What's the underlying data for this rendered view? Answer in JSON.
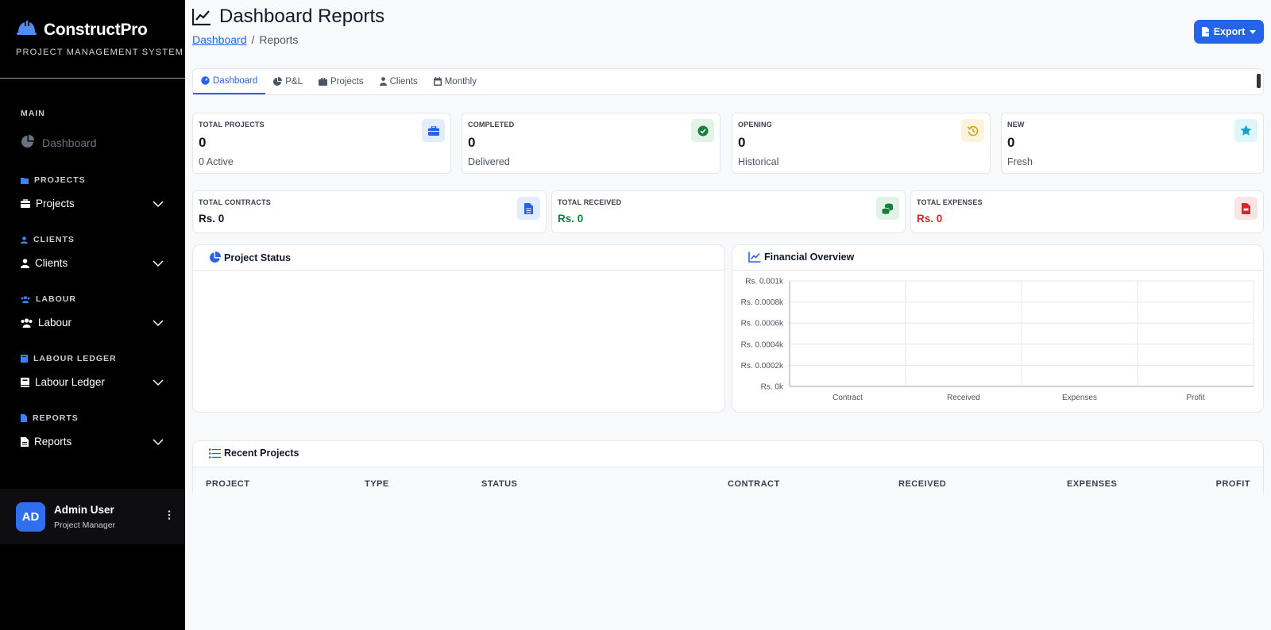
{
  "sidebar": {
    "brand_title": "ConstructPro",
    "brand_subtitle": "PROJECT MANAGEMENT SYSTEM",
    "main_label": "MAIN",
    "dashboard_label": "Dashboard",
    "sections": [
      {
        "header": "PROJECTS",
        "item": "Projects"
      },
      {
        "header": "CLIENTS",
        "item": "Clients"
      },
      {
        "header": "LABOUR",
        "item": "Labour"
      },
      {
        "header": "LABOUR LEDGER",
        "item": "Labour Ledger"
      },
      {
        "header": "REPORTS",
        "item": "Reports"
      }
    ],
    "user": {
      "initials": "AD",
      "name": "Admin User",
      "role": "Project Manager"
    }
  },
  "header": {
    "title": "Dashboard Reports",
    "breadcrumb_link": "Dashboard",
    "breadcrumb_separator": "/",
    "breadcrumb_current": "Reports",
    "export_label": "Export"
  },
  "tabs": [
    {
      "label": "Dashboard",
      "icon": "gauge-icon"
    },
    {
      "label": "P&L",
      "icon": "pie-icon"
    },
    {
      "label": "Projects",
      "icon": "briefcase-icon"
    },
    {
      "label": "Clients",
      "icon": "user-icon"
    },
    {
      "label": "Monthly",
      "icon": "calendar-icon"
    }
  ],
  "stats": [
    {
      "label": "TOTAL PROJECTS",
      "value": "0",
      "sub": "0 Active",
      "icon": "briefcase-icon",
      "color": "#2563eb",
      "bg": "#e3ecfd"
    },
    {
      "label": "COMPLETED",
      "value": "0",
      "sub": "Delivered",
      "icon": "check-circle-icon",
      "color": "#15803d",
      "bg": "#e1f3e7"
    },
    {
      "label": "OPENING",
      "value": "0",
      "sub": "Historical",
      "icon": "history-icon",
      "color": "#d69e0b",
      "bg": "#fdf3dc"
    },
    {
      "label": "NEW",
      "value": "0",
      "sub": "Fresh",
      "icon": "star-icon",
      "color": "#0ea5c6",
      "bg": "#def5fa"
    }
  ],
  "money": [
    {
      "label": "TOTAL CONTRACTS",
      "value": "Rs. 0",
      "icon": "file-icon",
      "color": "#111827",
      "icon_color": "#2563eb",
      "bg": "#e3ecfd"
    },
    {
      "label": "TOTAL RECEIVED",
      "value": "Rs. 0",
      "icon": "coins-icon",
      "color": "#15803d",
      "icon_color": "#15803d",
      "bg": "#e1f3e7"
    },
    {
      "label": "TOTAL EXPENSES",
      "value": "Rs. 0",
      "icon": "invoice-icon",
      "color": "#dc2626",
      "icon_color": "#dc2626",
      "bg": "#fde4e4"
    }
  ],
  "panels": {
    "project_status": "Project Status",
    "financial_overview": "Financial Overview",
    "recent_projects": "Recent Projects"
  },
  "chart_data": {
    "type": "bar",
    "categories": [
      "Contract",
      "Received",
      "Expenses",
      "Profit"
    ],
    "values": [
      0,
      0,
      0,
      0
    ],
    "title": "Financial Overview",
    "y_tick_labels": [
      "Rs. 0k",
      "Rs. 0.0002k",
      "Rs. 0.0004k",
      "Rs. 0.0006k",
      "Rs. 0.0008k",
      "Rs. 0.001k"
    ],
    "ylim": [
      0,
      0.001
    ],
    "grid": true
  },
  "table": {
    "columns": [
      "PROJECT",
      "TYPE",
      "STATUS",
      "CONTRACT",
      "RECEIVED",
      "EXPENSES",
      "PROFIT"
    ],
    "rows": []
  }
}
